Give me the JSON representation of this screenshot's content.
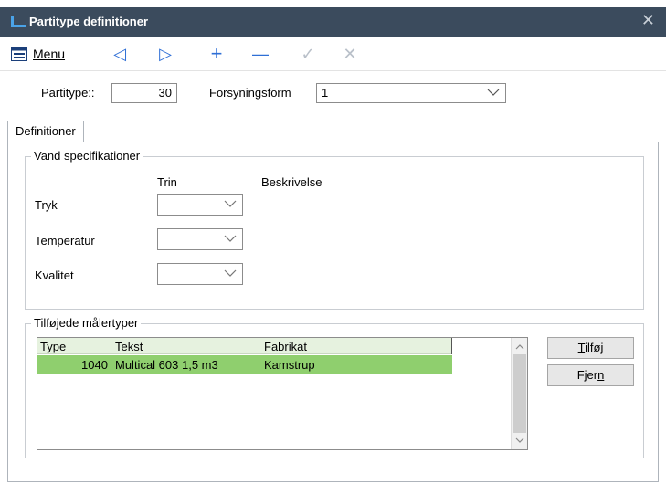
{
  "window": {
    "title": "Partitype definitioner",
    "close_glyph": "✕"
  },
  "toolbar": {
    "menu_label": "Menu",
    "prev_glyph": "◁",
    "next_glyph": "▷",
    "add_glyph": "+",
    "remove_glyph": "—",
    "confirm_glyph": "✓",
    "cancel_glyph": "✕"
  },
  "header": {
    "partitype_label": "Partitype::",
    "partitype_value": "30",
    "forsyning_label": "Forsyningsform",
    "forsyning_value": "1"
  },
  "tabs": [
    {
      "label": "Definitioner"
    }
  ],
  "vand": {
    "title": "Vand specifikationer",
    "col_trin": "Trin",
    "col_beskrivelse": "Beskrivelse",
    "rows": [
      {
        "label": "Tryk",
        "value": ""
      },
      {
        "label": "Temperatur",
        "value": ""
      },
      {
        "label": "Kvalitet",
        "value": ""
      }
    ]
  },
  "maalertyper": {
    "title": "Tilføjede målertyper",
    "columns": [
      "Type",
      "Tekst",
      "Fabrikat"
    ],
    "rows": [
      {
        "type": "1040",
        "tekst": "Multical 603 1,5 m3",
        "fabrikat": "Kamstrup"
      }
    ],
    "add_button": {
      "pre": "",
      "u": "T",
      "post": "ilføj"
    },
    "remove_button": {
      "pre": "Fjer",
      "u": "n",
      "post": ""
    }
  },
  "colors": {
    "titlebar": "#3b4b5d",
    "accent_blue": "#2f6fd6",
    "selected_row": "#8fcf6e",
    "header_green": "#e6f2df"
  }
}
